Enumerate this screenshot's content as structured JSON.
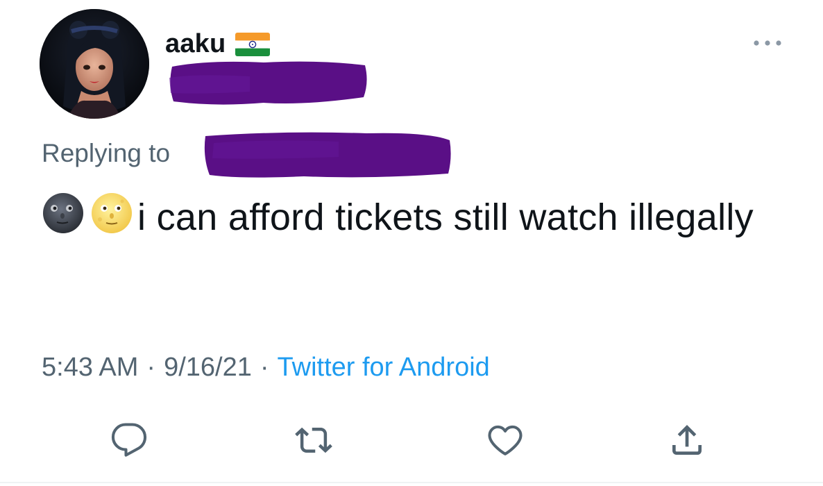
{
  "tweet": {
    "display_name": "aaku",
    "flag_icon": "india-flag-icon",
    "more_icon": "more-options-icon",
    "replying_label": "Replying to",
    "text_emojis": [
      "new-moon-face-emoji",
      "full-moon-face-emoji"
    ],
    "text": "i can afford tickets still watch illegally",
    "time": "5:43 AM",
    "separator": "·",
    "date": "9/16/21",
    "source": "Twitter for Android",
    "redaction_color": "#5a0f86"
  },
  "actions": [
    {
      "name": "reply",
      "icon": "reply-icon"
    },
    {
      "name": "retweet",
      "icon": "retweet-icon"
    },
    {
      "name": "like",
      "icon": "heart-icon"
    },
    {
      "name": "share",
      "icon": "share-icon"
    }
  ],
  "colors": {
    "text_primary": "#0f1419",
    "text_secondary": "#536471",
    "link": "#1d9bf0"
  }
}
